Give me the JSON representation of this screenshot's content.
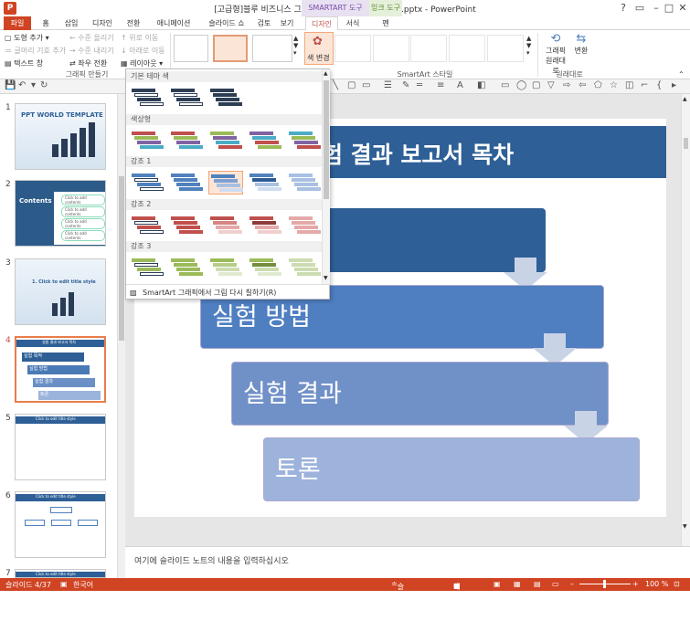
{
  "window": {
    "title": "[고급형]블루 비즈니스 그래프 템플릿(자동완성형포함).pptx - PowerPoint",
    "help": "?",
    "minimize": "–",
    "restore": "□",
    "close": "✕"
  },
  "context_tabs": {
    "smartart": "SMARTART 도구",
    "ink": "잉크 도구"
  },
  "tabs": [
    "파일",
    "홈",
    "삽입",
    "디자인",
    "전환",
    "애니메이션",
    "슬라이드 쇼",
    "검토",
    "보기",
    "디자인",
    "서식",
    "펜"
  ],
  "ribbon": {
    "create_graphic": {
      "add_shape": "도형 추가",
      "add_bullet": "글머리 기호 추가",
      "text_pane": "텍스트 창",
      "promote": "수준 올리기",
      "demote": "수준 내리기",
      "right_to_left": "좌우 전환",
      "move_up": "위로 이동",
      "move_down": "아래로 이동",
      "layout": "레이아웃",
      "label": "그래픽 만들기"
    },
    "change_colors": "색 변경",
    "smartart_styles_label": "SmartArt 스타일",
    "reset": {
      "reset_graphic": "그래픽 원래대로",
      "convert": "변환",
      "label": "원래대로"
    }
  },
  "dropdown": {
    "categories": [
      "기본 테마 색",
      "색상형",
      "강조 1",
      "강조 2",
      "강조 3"
    ],
    "footer": "SmartArt 그래픽에서 그림 다시 칠하기(R)",
    "palette": {
      "dark": "#2d3e54",
      "accent1": "#4f81bd",
      "accent2": "#c0504d",
      "accent3": "#9bbb59",
      "accent4": "#8064a2",
      "accent5": "#4bacc6"
    }
  },
  "slides": [
    {
      "num": "1",
      "title": "PPT WORLD TEMPLATE"
    },
    {
      "num": "2",
      "title": "Contents",
      "items": [
        "Click to add contents",
        "Click to add contents",
        "Click to add contents",
        "Click to add contents"
      ]
    },
    {
      "num": "3",
      "title": "1. Click to edit title style"
    },
    {
      "num": "4",
      "title": "실험 결과 보고서 목차",
      "items": [
        "실험 목적",
        "실험 방법",
        "실험 결과",
        "토론"
      ]
    },
    {
      "num": "5",
      "title": "Click to edit title style"
    },
    {
      "num": "6",
      "title": "Click to edit title style"
    },
    {
      "num": "7",
      "title": "Click to edit title style"
    }
  ],
  "slide": {
    "title": "험 결과 보고서 목차",
    "steps": [
      "실험 방법",
      "실험 결과",
      "토론"
    ]
  },
  "notes_placeholder": "여기에 슬라이드 노트의 내용을 입력하십시오",
  "status": {
    "slide": "슬라이드 4/37",
    "language": "한국어",
    "notes": "슬라이드 노트",
    "comments": "메모",
    "zoom": "100 %"
  }
}
